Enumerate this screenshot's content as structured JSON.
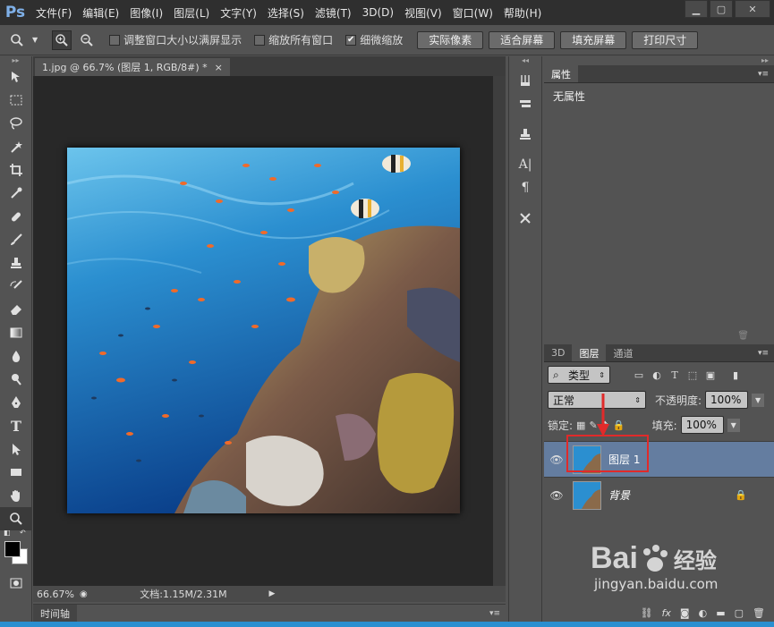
{
  "app": {
    "logo": "Ps"
  },
  "menu": [
    "文件(F)",
    "编辑(E)",
    "图像(I)",
    "图层(L)",
    "文字(Y)",
    "选择(S)",
    "滤镜(T)",
    "3D(D)",
    "视图(V)",
    "窗口(W)",
    "帮助(H)"
  ],
  "options": {
    "chk_resize": "调整窗口大小以满屏显示",
    "chk_zoom_all": "缩放所有窗口",
    "chk_scrubby": "细微缩放",
    "btn_actual": "实际像素",
    "btn_fit": "适合屏幕",
    "btn_fill": "填充屏幕",
    "btn_print": "打印尺寸"
  },
  "document": {
    "tab_title": "1.jpg @ 66.7% (图层 1, RGB/8#) *",
    "close": "×"
  },
  "status": {
    "zoom": "66.67%",
    "doc_info": "文档:1.15M/2.31M"
  },
  "timeline": {
    "tab": "时间轴"
  },
  "properties": {
    "tab": "属性",
    "body": "无属性"
  },
  "layers": {
    "tabs": [
      "3D",
      "图层",
      "通道"
    ],
    "filter_kind": "类型",
    "blend_mode": "正常",
    "opacity_label": "不透明度:",
    "opacity_value": "100%",
    "lock_label": "锁定:",
    "fill_label": "填充:",
    "fill_value": "100%",
    "items": [
      {
        "name": "图层 1",
        "selected": true
      },
      {
        "name": "背景",
        "selected": false
      }
    ]
  },
  "watermark": {
    "brand": "Bai",
    "brand_suffix": "经验",
    "url": "jingyan.baidu.com"
  },
  "colors": {
    "accent_blue": "#2a8fd0",
    "highlight_red": "#e02a2a",
    "selected_layer": "#647da0"
  }
}
